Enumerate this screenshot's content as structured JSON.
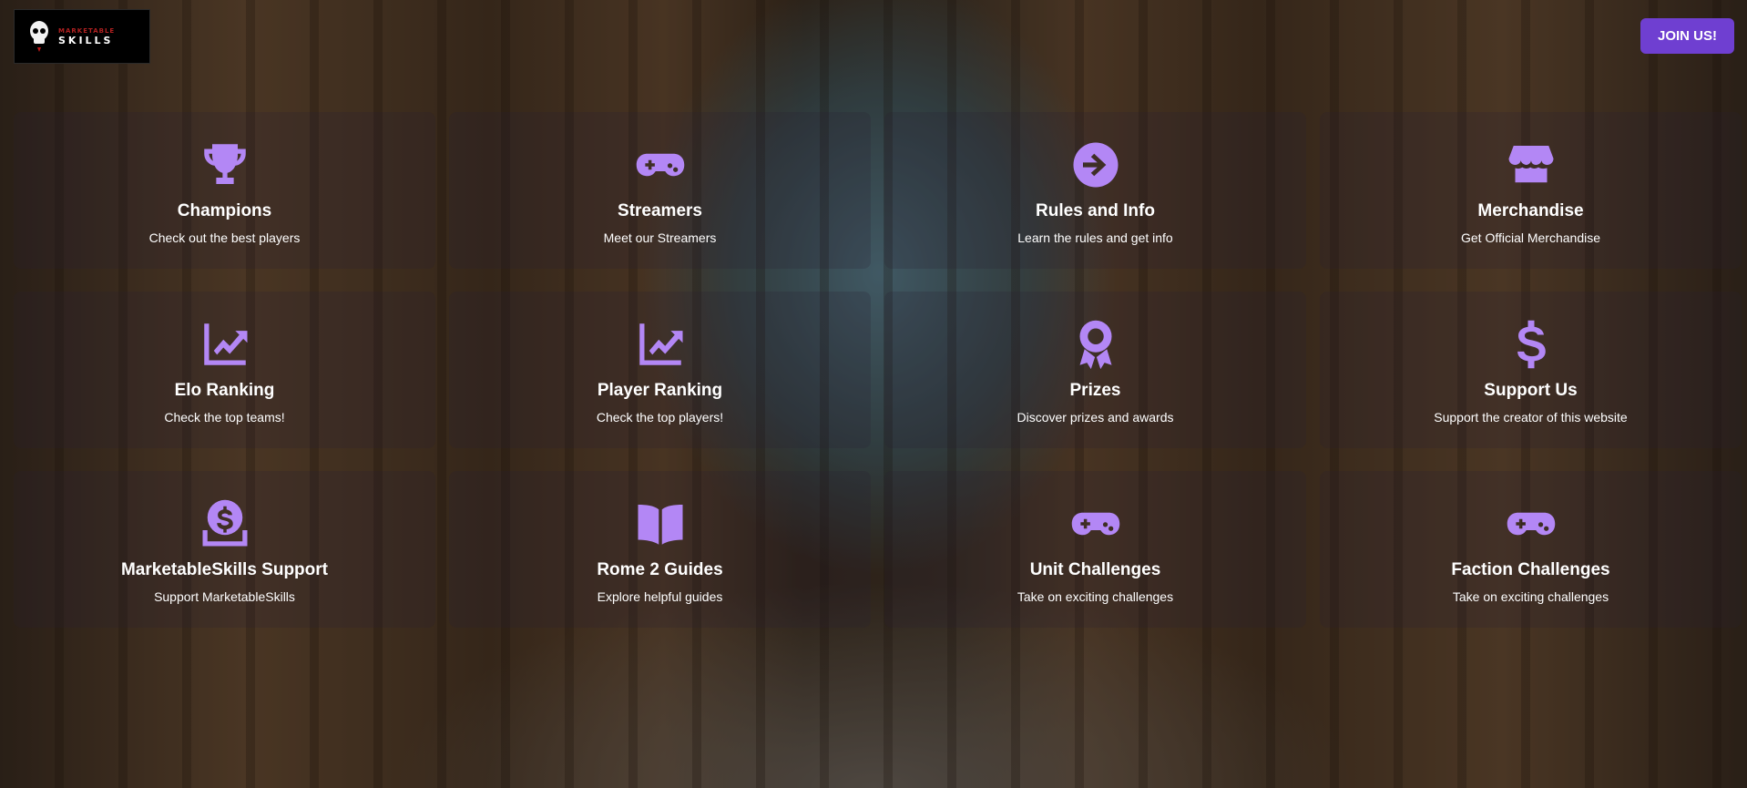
{
  "header": {
    "logo_text": "SKILLS",
    "join_button": "JOIN US!"
  },
  "cards": [
    {
      "title": "Champions",
      "description": "Check out the best players",
      "icon": "trophy-icon"
    },
    {
      "title": "Streamers",
      "description": "Meet our Streamers",
      "icon": "gamepad-icon"
    },
    {
      "title": "Rules and Info",
      "description": "Learn the rules and get info",
      "icon": "arrow-right-circle-icon"
    },
    {
      "title": "Merchandise",
      "description": "Get Official Merchandise",
      "icon": "store-icon"
    },
    {
      "title": "Elo Ranking",
      "description": "Check the top teams!",
      "icon": "chart-line-icon"
    },
    {
      "title": "Player Ranking",
      "description": "Check the top players!",
      "icon": "chart-line-icon"
    },
    {
      "title": "Prizes",
      "description": "Discover prizes and awards",
      "icon": "award-icon"
    },
    {
      "title": "Support Us",
      "description": "Support the creator of this website",
      "icon": "dollar-icon"
    },
    {
      "title": "MarketableSkills Support",
      "description": "Support MarketableSkills",
      "icon": "money-bag-icon"
    },
    {
      "title": "Rome 2 Guides",
      "description": "Explore helpful guides",
      "icon": "book-icon"
    },
    {
      "title": "Unit Challenges",
      "description": "Take on exciting challenges",
      "icon": "gamepad-icon"
    },
    {
      "title": "Faction Challenges",
      "description": "Take on exciting challenges",
      "icon": "gamepad-icon"
    }
  ],
  "colors": {
    "accent": "#b387f5",
    "button": "#6f3fd1"
  }
}
